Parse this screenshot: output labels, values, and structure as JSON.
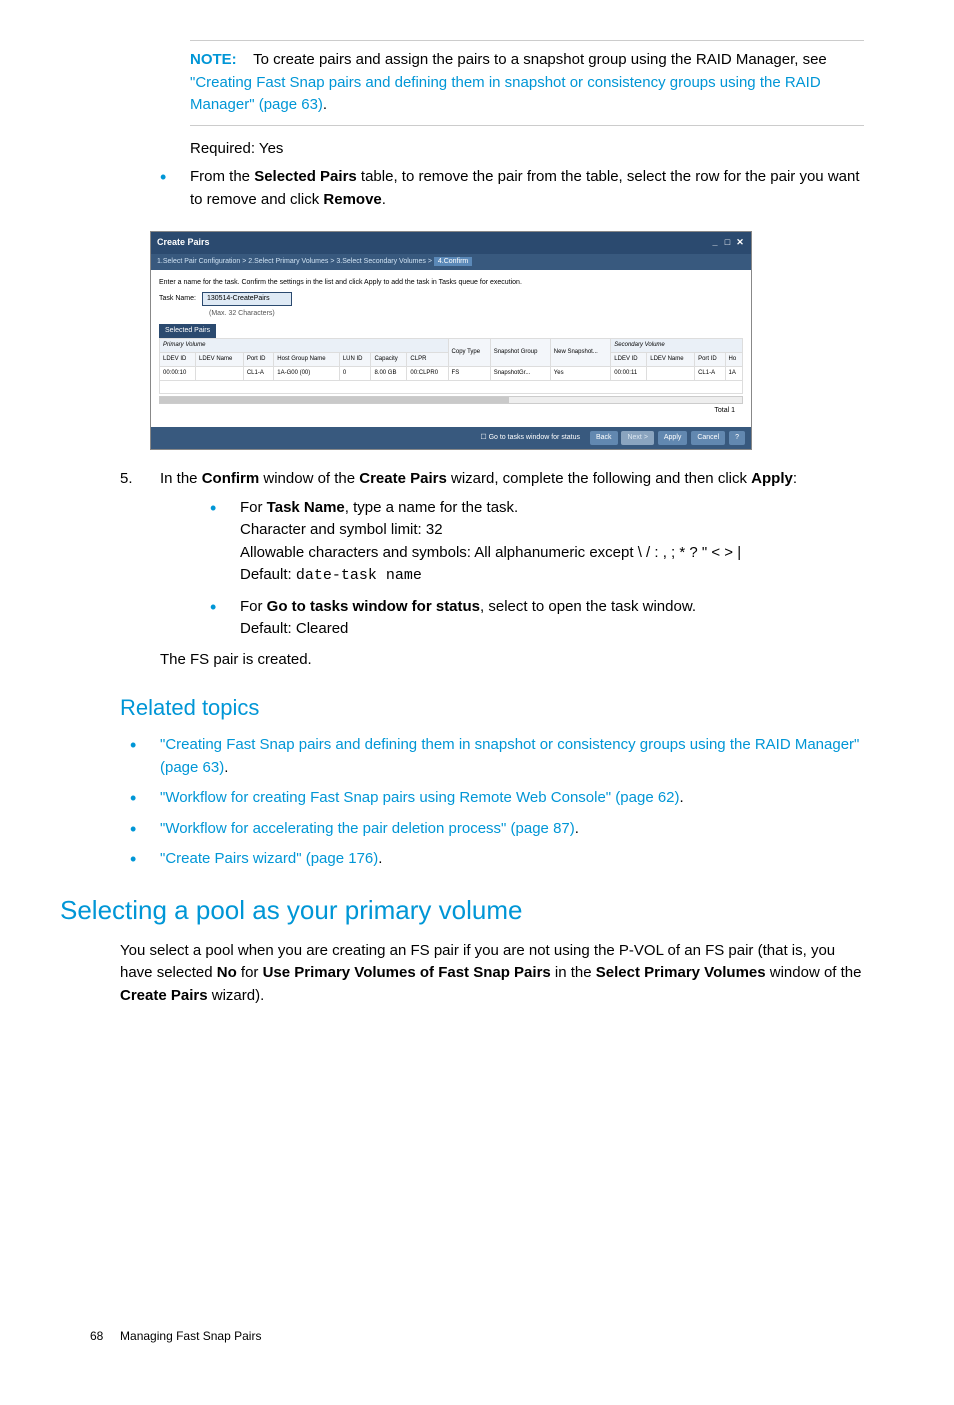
{
  "note": {
    "label": "NOTE:",
    "before": "To create pairs and assign the pairs to a snapshot group using the RAID Manager, see ",
    "link": "\"Creating Fast Snap pairs and defining them in snapshot or consistency groups using the RAID Manager\" (page 63)",
    "after": "."
  },
  "required_line": "Required: Yes",
  "bullet_remove": {
    "p1a": "From the ",
    "p1b": "Selected Pairs",
    "p1c": " table, to remove the pair from the table, select the row for the pair you want to remove and click ",
    "p1d": "Remove",
    "p1e": "."
  },
  "wizard": {
    "title": "Create Pairs",
    "crumb1": "1.Select Pair Configuration",
    "crumb2": "2.Select Primary Volumes",
    "crumb3": "3.Select Secondary Volumes",
    "crumb4": "4.Confirm",
    "sep": " > ",
    "instruction": "Enter a name for the task. Confirm the settings in the list and click Apply to add the task in Tasks queue for execution.",
    "task_label": "Task Name:",
    "task_value": "130514-CreatePairs",
    "task_hint": "(Max. 32 Characters)",
    "tab": "Selected Pairs",
    "group_primary": "Primary Volume",
    "group_secondary": "Secondary Volume",
    "headers": {
      "ldev_id": "LDEV ID",
      "ldev_name": "LDEV Name",
      "port_id": "Port ID",
      "host_group": "Host Group Name",
      "lun_id": "LUN ID",
      "capacity": "Capacity",
      "clpr": "CLPR",
      "copy_type": "Copy Type",
      "snap_group": "Snapshot Group",
      "new_snap": "New Snapshot...",
      "ho": "Ho"
    },
    "row": {
      "ldev_id": "00:00:10",
      "ldev_name": "",
      "port_id": "CL1-A",
      "host_group": "1A-G00 (00)",
      "lun_id": "0",
      "capacity": "8.00 GB",
      "clpr": "00:CLPR0",
      "copy_type": "FS",
      "snap_group": "SnapshotGr...",
      "new_snap": "Yes",
      "s_ldev_id": "00:00:11",
      "s_ldev_name": "",
      "s_port_id": "CL1-A",
      "s_ho": "1A"
    },
    "total": "Total  1",
    "checkbox": "Go to tasks window for status",
    "btn_back": "Back",
    "btn_next": "Next >",
    "btn_apply": "Apply",
    "btn_cancel": "Cancel",
    "btn_help": "?"
  },
  "step5": {
    "num": "5.",
    "p_a": "In the ",
    "p_b": "Confirm",
    "p_c": " window of the ",
    "p_d": "Create Pairs",
    "p_e": " wizard, complete the following and then click ",
    "p_f": "Apply",
    "p_g": ":",
    "b1a": "For ",
    "b1b": "Task Name",
    "b1c": ", type a name for the task.",
    "b1d": "Character and symbol limit: 32",
    "b1e": "Allowable characters and symbols: All alphanumeric except \\ / : , ; * ? \" < > |",
    "b1f_a": "Default: ",
    "b1f_b": "date-task name",
    "b2a": "For ",
    "b2b": "Go to tasks window for status",
    "b2c": ", select to open the task window.",
    "b2d": "Default: Cleared",
    "closing": "The FS pair is created."
  },
  "related": {
    "heading": "Related topics",
    "t1": "\"Creating Fast Snap pairs and defining them in snapshot or consistency groups using the RAID Manager\" (page 63)",
    "t2": "\"Workflow for creating Fast Snap pairs using Remote Web Console\" (page 62)",
    "t3": "\"Workflow for accelerating the pair deletion process\" (page 87)",
    "t4": "\"Create Pairs wizard\" (page 176)",
    "dot": "."
  },
  "section2": {
    "heading": "Selecting a pool as your primary volume",
    "p_a": "You select a pool when you are creating an FS pair if you are not using the P-VOL of an FS pair (that is, you have selected ",
    "p_b": "No",
    "p_c": " for ",
    "p_d": "Use Primary Volumes of Fast Snap Pairs",
    "p_e": " in the ",
    "p_f": "Select Primary Volumes",
    "p_g": " window of the ",
    "p_h": "Create Pairs",
    "p_i": " wizard)."
  },
  "footer": {
    "page": "68",
    "title": "Managing Fast Snap Pairs"
  }
}
